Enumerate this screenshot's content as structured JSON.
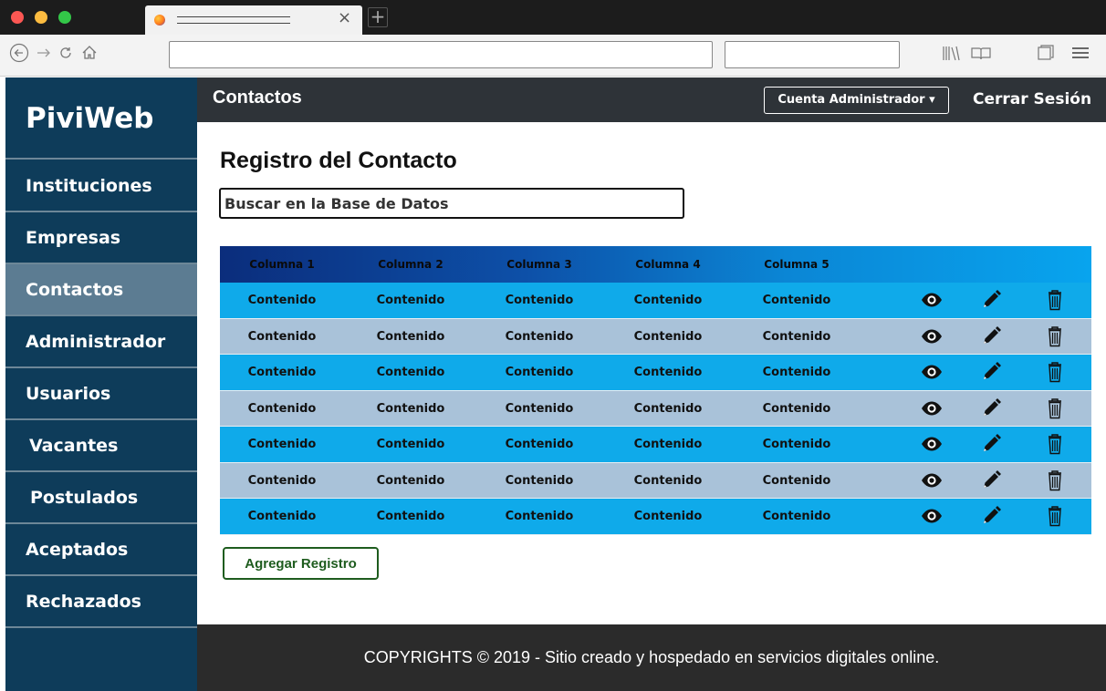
{
  "browser": {
    "tab_close_glyph": "×",
    "new_tab_glyph": "+",
    "nav_icons": [
      "back-icon",
      "forward-icon",
      "reload-icon",
      "home-icon"
    ],
    "toolbar_icons": [
      "library-icon",
      "reader-view-icon",
      "sidebar-toggle-icon",
      "hamburger-menu-icon"
    ]
  },
  "sidebar": {
    "brand": "PiviWeb",
    "items": [
      {
        "label": "Instituciones"
      },
      {
        "label": "Empresas"
      },
      {
        "label": "Contactos",
        "active": true
      },
      {
        "label": "Administrador"
      },
      {
        "label": "Usuarios"
      },
      {
        "label": "Vacantes"
      },
      {
        "label": "Postulados"
      },
      {
        "label": "Aceptados"
      },
      {
        "label": "Rechazados"
      }
    ]
  },
  "header": {
    "title": "Contactos",
    "account_button": "Cuenta Administrador ▾",
    "logout": "Cerrar Sesión"
  },
  "main": {
    "heading": "Registro del Contacto",
    "search_placeholder": "Buscar en la Base de Datos",
    "add_button": "Agregar Registro"
  },
  "table": {
    "columns": [
      "Columna 1",
      "Columna 2",
      "Columna 3",
      "Columna 4",
      "Columna 5"
    ],
    "rows": [
      [
        "Contenido",
        "Contenido",
        "Contenido",
        "Contenido",
        "Contenido"
      ],
      [
        "Contenido",
        "Contenido",
        "Contenido",
        "Contenido",
        "Contenido"
      ],
      [
        "Contenido",
        "Contenido",
        "Contenido",
        "Contenido",
        "Contenido"
      ],
      [
        "Contenido",
        "Contenido",
        "Contenido",
        "Contenido",
        "Contenido"
      ],
      [
        "Contenido",
        "Contenido",
        "Contenido",
        "Contenido",
        "Contenido"
      ],
      [
        "Contenido",
        "Contenido",
        "Contenido",
        "Contenido",
        "Contenido"
      ],
      [
        "Contenido",
        "Contenido",
        "Contenido",
        "Contenido",
        "Contenido"
      ]
    ],
    "row_actions": [
      "eye-icon",
      "pencil-icon",
      "trash-icon"
    ],
    "row_colors": {
      "blue": "#0faaea",
      "grey": "#a9c2d9"
    }
  },
  "footer": {
    "text": "COPYRIGHTS © 2019 - Sitio creado y hospedado en servicios digitales online."
  },
  "colors": {
    "sidebar": "#0e3c5a",
    "sidebar_active": "#5c7c92",
    "topbar": "#2e3338",
    "footer": "#2b2b2b",
    "add_button": "#1e5c1e"
  }
}
